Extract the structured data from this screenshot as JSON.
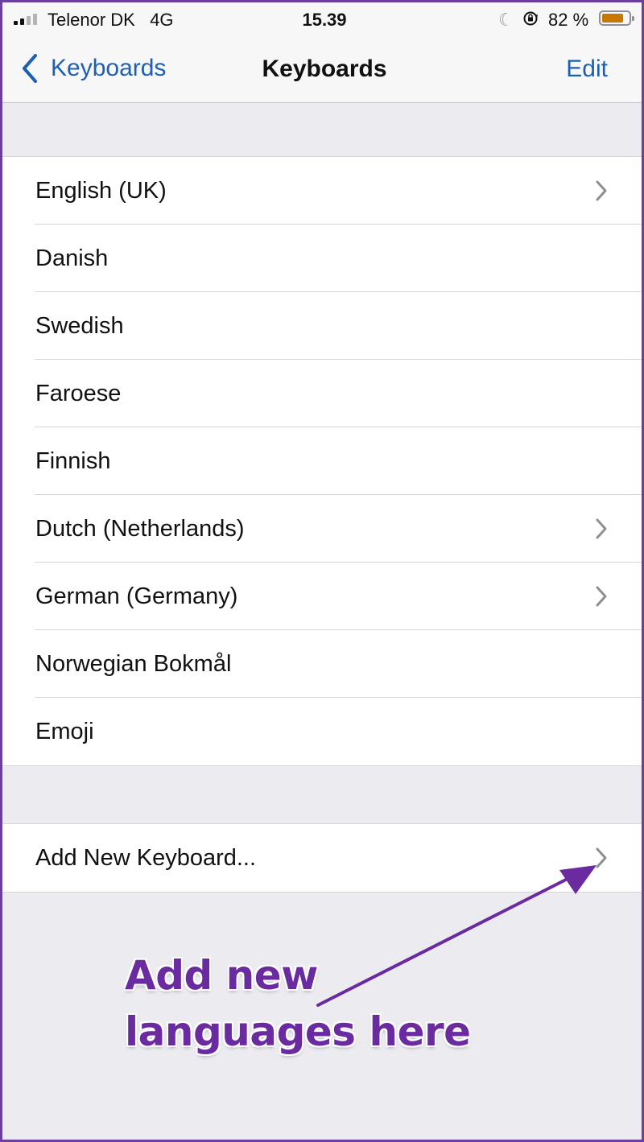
{
  "status_bar": {
    "carrier": "Telenor DK",
    "network": "4G",
    "time": "15.39",
    "battery_percent": "82 %",
    "battery_level": 0.82,
    "battery_color": "#c87800",
    "icons": [
      "signal-icon",
      "moon-icon",
      "orientation-lock-icon",
      "battery-icon"
    ]
  },
  "nav": {
    "back_label": "Keyboards",
    "title": "Keyboards",
    "edit_label": "Edit",
    "accent_color": "#1d5fb0"
  },
  "keyboards": [
    {
      "label": "English (UK)",
      "chevron": true
    },
    {
      "label": "Danish",
      "chevron": false
    },
    {
      "label": "Swedish",
      "chevron": false
    },
    {
      "label": "Faroese",
      "chevron": false
    },
    {
      "label": "Finnish",
      "chevron": false
    },
    {
      "label": "Dutch (Netherlands)",
      "chevron": true
    },
    {
      "label": "German (Germany)",
      "chevron": true
    },
    {
      "label": "Norwegian Bokmål",
      "chevron": false
    },
    {
      "label": "Emoji",
      "chevron": false
    }
  ],
  "add_keyboard": {
    "label": "Add New Keyboard...",
    "chevron": true
  },
  "annotation": {
    "lines": [
      "Add new",
      "languages here"
    ],
    "color": "#6a2aa0"
  }
}
